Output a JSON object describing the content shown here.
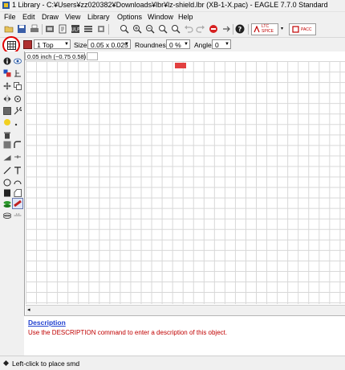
{
  "window": {
    "title": "1 Library - C:¥Users¥zz020382¥Downloads¥lbr¥lz-shield.lbr (XB-1-X.pac) - EAGLE 7.7.0 Standard"
  },
  "menu": [
    "File",
    "Edit",
    "Draw",
    "View",
    "Library",
    "Options",
    "Window",
    "Help"
  ],
  "toolbar": {
    "spice_label": "SPICE",
    "spice_top": "LTC",
    "pacc_label": "PACC"
  },
  "parameters": {
    "layer_value": "1 Top",
    "size_label": "Size:",
    "size_value": "0.05 x 0.025",
    "roundness_label": "Roundness:",
    "roundness_value": "0 %",
    "angle_label": "Angle:",
    "angle_value": "0"
  },
  "canvas": {
    "coordinate_readout": "0.05 inch (−0.75 0.58)"
  },
  "description": {
    "heading": "Description",
    "text": "Use the DESCRIPTION command to enter a description of this object."
  },
  "status": {
    "text": "Left-click to place smd"
  },
  "colors": {
    "layer_swatch": "#b03030",
    "pad": "#e24040",
    "highlight_ring": "#e00000",
    "description_heading": "#1f3fd0",
    "description_text": "#c00000"
  },
  "icons": [
    "app-icon",
    "open-icon",
    "save-icon",
    "print-icon",
    "cam-icon",
    "script-icon",
    "ulp-icon",
    "zoom-fit-icon",
    "zoom-in-icon",
    "zoom-out-icon",
    "undo-icon",
    "redo-icon",
    "stop-icon",
    "help-icon",
    "grid-icon",
    "info-icon",
    "arrow-icon"
  ]
}
